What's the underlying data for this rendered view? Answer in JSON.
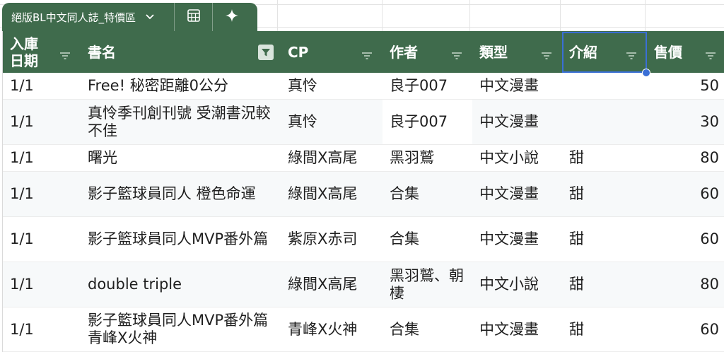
{
  "table": {
    "name": "絕版BL中文同人誌_特價區",
    "columns": [
      "入庫\n日期",
      "書名",
      "CP",
      "作者",
      "類型",
      "介紹",
      "售價"
    ],
    "rows": [
      [
        "1/1",
        "Free! 秘密距離0公分",
        "真怜",
        "良子007",
        "中文漫畫",
        "",
        "50"
      ],
      [
        "1/1",
        "真怜季刊創刊號 受潮書況較不佳",
        "真怜",
        "良子007",
        "中文漫畫",
        "",
        "30"
      ],
      [
        "1/1",
        "曙光",
        "綠間X高尾",
        "黑羽鷲",
        "中文小說",
        "甜",
        "80"
      ],
      [
        "1/1",
        "影子籃球員同人 橙色命運",
        "綠間X高尾",
        "合集",
        "中文漫畫",
        "甜",
        "60"
      ],
      [
        "1/1",
        "影子籃球員同人MVP番外篇",
        "紫原X赤司",
        "合集",
        "中文漫畫",
        "甜",
        "60"
      ],
      [
        "1/1",
        "double triple",
        "綠間X高尾",
        "黑羽鷲、朝棲",
        "中文小說",
        "甜",
        "80"
      ],
      [
        "1/1",
        "影子籃球員同人MVP番外篇 青峰X火神",
        "青峰X火神",
        "合集",
        "中文漫畫",
        "甜",
        "60"
      ]
    ]
  },
  "icons": {
    "tab_dropdown": "chevron-down-icon",
    "calculator": "calculator-icon",
    "sparkle": "sparkle-icon",
    "filter": "filter-icon",
    "filter_active": "filter-active-icon"
  },
  "colors": {
    "header_bg": "#3f6b4c",
    "selection": "#3a6fd6",
    "text": "#1f1f1f"
  }
}
